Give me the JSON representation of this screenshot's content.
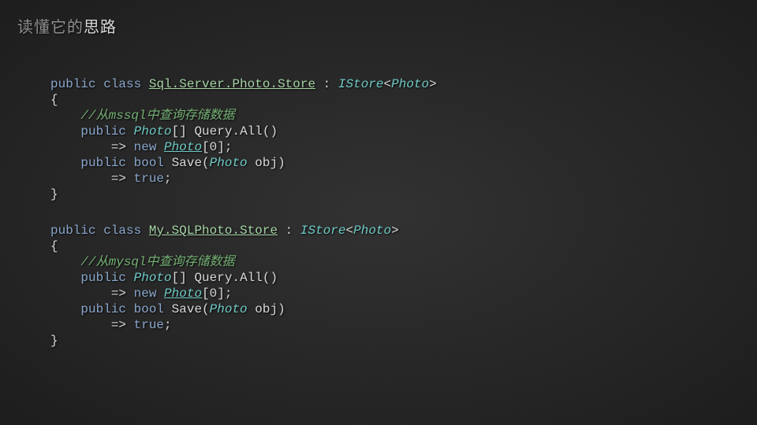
{
  "title": {
    "prefix": "读懂它的",
    "emph": "思路"
  },
  "code1": {
    "l1_public": "public",
    "l1_class": "class",
    "l1_name": "Sql.Server.Photo.Store",
    "l1_colon": " : ",
    "l1_istore": "IStore",
    "l1_open": "<",
    "l1_photo": "Photo",
    "l1_close": ">",
    "l2_brace": "{",
    "l3_comment": "//从mssql中查询存储数据",
    "l4_public": "public",
    "l4_type": "Photo",
    "l4_arr": "[] ",
    "l4_method": "Query.All()",
    "l5_arrow": "=>",
    "l5_new": "new",
    "l5_photo": "Photo",
    "l5_idx": "[0];",
    "l6_public": "public",
    "l6_bool": "bool",
    "l6_save": " Save(",
    "l6_photo": "Photo",
    "l6_obj": " obj)",
    "l7_arrow": "=>",
    "l7_true": "true",
    "l7_semi": ";",
    "l8_brace": "}"
  },
  "code2": {
    "l1_public": "public",
    "l1_class": "class",
    "l1_name": "My.SQLPhoto.Store",
    "l1_colon": " : ",
    "l1_istore": "IStore",
    "l1_open": "<",
    "l1_photo": "Photo",
    "l1_close": ">",
    "l2_brace": "{",
    "l3_comment": "//从mysql中查询存储数据",
    "l4_public": "public",
    "l4_type": "Photo",
    "l4_arr": "[] ",
    "l4_method": "Query.All()",
    "l5_arrow": "=>",
    "l5_new": "new",
    "l5_photo": "Photo",
    "l5_idx": "[0];",
    "l6_public": "public",
    "l6_bool": "bool",
    "l6_save": " Save(",
    "l6_photo": "Photo",
    "l6_obj": " obj)",
    "l7_arrow": "=>",
    "l7_true": "true",
    "l7_semi": ";",
    "l8_brace": "}"
  }
}
